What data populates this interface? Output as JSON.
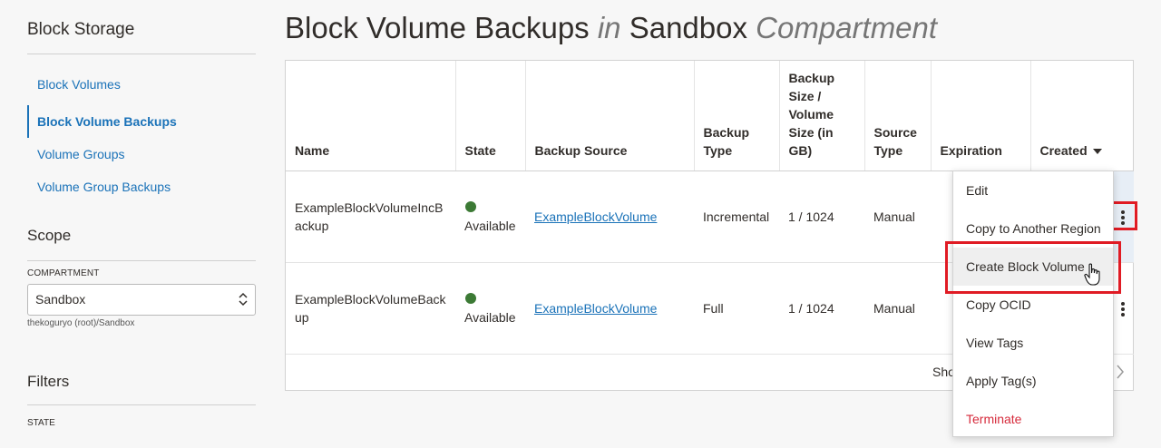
{
  "sidebar": {
    "title": "Block Storage",
    "nav": [
      {
        "label": "Block Volumes",
        "active": false
      },
      {
        "label": "Block Volume Backups",
        "active": true
      },
      {
        "label": "Volume Groups",
        "active": false
      },
      {
        "label": "Volume Group Backups",
        "active": false
      }
    ],
    "scope_title": "Scope",
    "compartment_label": "COMPARTMENT",
    "compartment_value": "Sandbox",
    "compartment_path": "thekoguryo (root)/Sandbox",
    "filters_title": "Filters",
    "state_label": "STATE"
  },
  "header": {
    "title_main": "Block Volume Backups",
    "title_in": "in",
    "title_compartment": "Sandbox",
    "title_suffix": "Compartment"
  },
  "table": {
    "columns": [
      "Name",
      "State",
      "Backup Source",
      "Backup Type",
      "Backup Size / Volume Size (in GB)",
      "Source Type",
      "Expiration",
      "Created"
    ],
    "rows": [
      {
        "name": "ExampleBlockVolumeIncBackup",
        "state": "Available",
        "source": "ExampleBlockVolume",
        "type": "Incremental",
        "size": "1 / 1024",
        "source_type": "Manual",
        "expiration": ""
      },
      {
        "name": "ExampleBlockVolumeBackup",
        "state": "Available",
        "source": "ExampleBlockVolume",
        "type": "Full",
        "size": "1 / 1024",
        "source_type": "Manual",
        "expiration": ""
      }
    ],
    "footer_text": "Sho"
  },
  "menu": {
    "items": [
      "Edit",
      "Copy to Another Region",
      "Create Block Volume",
      "Copy OCID",
      "View Tags",
      "Apply Tag(s)",
      "Terminate"
    ]
  },
  "colors": {
    "link": "#1a72b8",
    "available": "#3c7a35",
    "highlight": "#e01b24",
    "danger": "#d62b3c"
  }
}
